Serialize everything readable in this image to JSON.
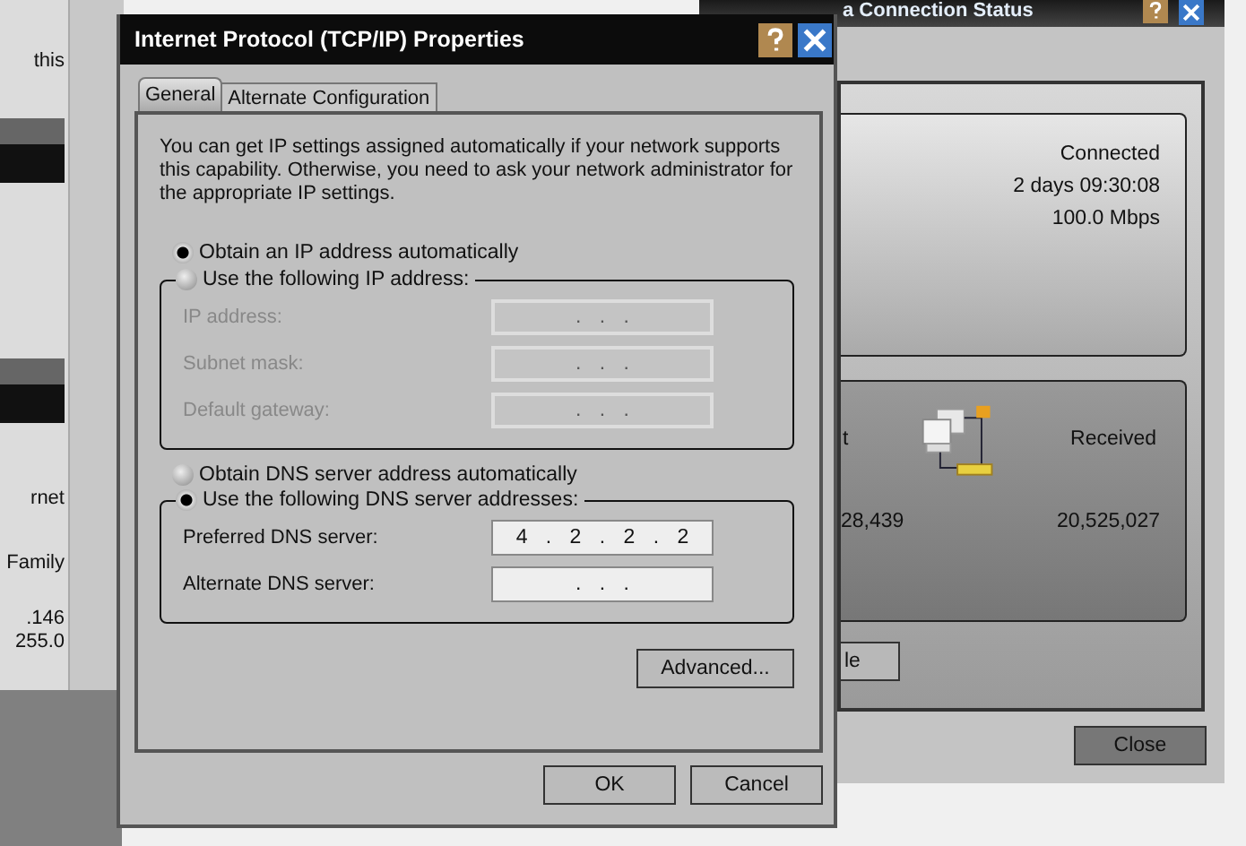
{
  "left_window": {
    "lines": [
      "this",
      "rnet",
      "Family",
      ".146",
      "255.0"
    ]
  },
  "status_window": {
    "title": "a Connection Status",
    "connection": {
      "status": "Connected",
      "duration": "2 days 09:30:08",
      "speed": "100.0 Mbps"
    },
    "activity": {
      "sent_label": "t",
      "received_label": "Received",
      "sent": "28,439",
      "received": "20,525,027"
    },
    "partial_button": "le",
    "close_button": "Close"
  },
  "dialog": {
    "title": "Internet Protocol (TCP/IP) Properties",
    "tabs": [
      {
        "label": "General",
        "selected": true
      },
      {
        "label": "Alternate Configuration",
        "selected": false
      }
    ],
    "intro": "You can get IP settings assigned automatically if your network supports this capability. Otherwise, you need to ask your network administrator for the appropriate IP settings.",
    "ip_auto": {
      "label": "Obtain an IP address automatically",
      "selected": true
    },
    "ip_manual": {
      "label": "Use the following IP address:",
      "selected": false,
      "fields": [
        {
          "label": "IP address:",
          "value": ". . .",
          "disabled": true
        },
        {
          "label": "Subnet mask:",
          "value": ". . .",
          "disabled": true
        },
        {
          "label": "Default gateway:",
          "value": ". . .",
          "disabled": true
        }
      ]
    },
    "dns_auto": {
      "label": "Obtain DNS server address automatically",
      "selected": false
    },
    "dns_manual": {
      "label": "Use the following DNS server addresses:",
      "selected": true,
      "fields": [
        {
          "label": "Preferred DNS server:",
          "value": "4 . 2 . 2 . 2",
          "disabled": false
        },
        {
          "label": "Alternate DNS server:",
          "value": ". . .",
          "disabled": false
        }
      ]
    },
    "advanced_button": "Advanced...",
    "buttons": [
      "OK",
      "Cancel"
    ]
  }
}
